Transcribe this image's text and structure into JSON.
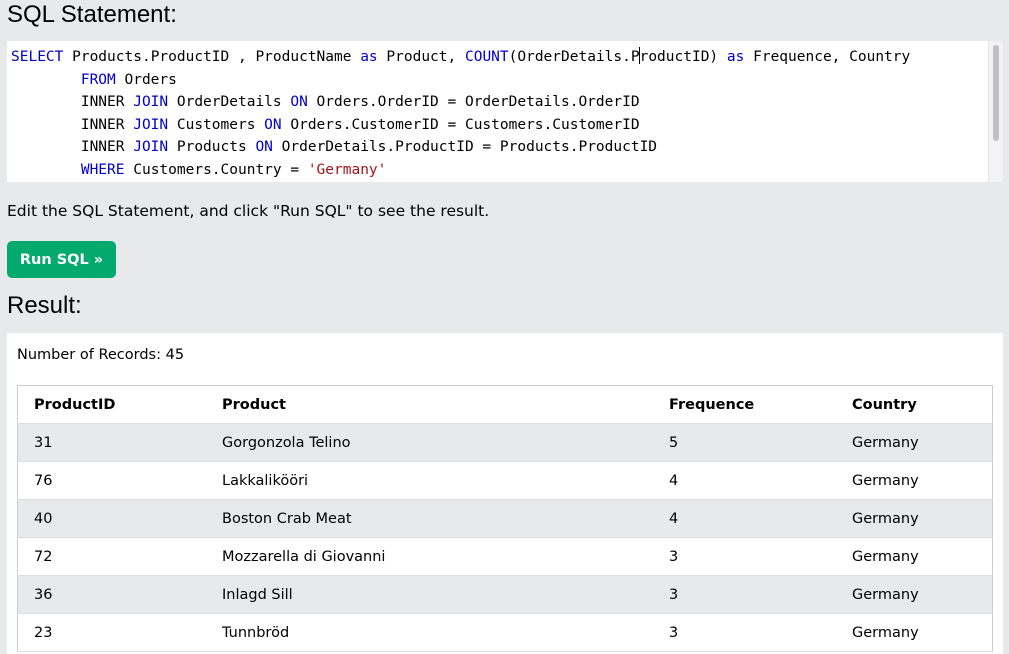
{
  "sql_section": {
    "title": "SQL Statement:",
    "lines": [
      [
        {
          "t": "SELECT",
          "k": "kw"
        },
        {
          "t": " Products.ProductID , ProductName ",
          "k": ""
        },
        {
          "t": "as",
          "k": "kw"
        },
        {
          "t": " Product, ",
          "k": ""
        },
        {
          "t": "COUNT",
          "k": "kw"
        },
        {
          "t": "(OrderDetails.P",
          "k": ""
        },
        {
          "t": "",
          "k": "cursor"
        },
        {
          "t": "roductID) ",
          "k": ""
        },
        {
          "t": "as",
          "k": "kw"
        },
        {
          "t": " Frequence, Country",
          "k": ""
        }
      ],
      [
        {
          "t": "        ",
          "k": ""
        },
        {
          "t": "FROM",
          "k": "kw"
        },
        {
          "t": " Orders",
          "k": ""
        }
      ],
      [
        {
          "t": "        INNER ",
          "k": ""
        },
        {
          "t": "JOIN",
          "k": "kw"
        },
        {
          "t": " OrderDetails ",
          "k": ""
        },
        {
          "t": "ON",
          "k": "kw"
        },
        {
          "t": " Orders.OrderID = OrderDetails.OrderID",
          "k": ""
        }
      ],
      [
        {
          "t": "        INNER ",
          "k": ""
        },
        {
          "t": "JOIN",
          "k": "kw"
        },
        {
          "t": " Customers ",
          "k": ""
        },
        {
          "t": "ON",
          "k": "kw"
        },
        {
          "t": " Orders.CustomerID = Customers.CustomerID",
          "k": ""
        }
      ],
      [
        {
          "t": "        INNER ",
          "k": ""
        },
        {
          "t": "JOIN",
          "k": "kw"
        },
        {
          "t": " Products ",
          "k": ""
        },
        {
          "t": "ON",
          "k": "kw"
        },
        {
          "t": " OrderDetails.ProductID = Products.ProductID",
          "k": ""
        }
      ],
      [
        {
          "t": "        ",
          "k": ""
        },
        {
          "t": "WHERE",
          "k": "kw"
        },
        {
          "t": " Customers.Country = ",
          "k": ""
        },
        {
          "t": "'Germany'",
          "k": "str"
        }
      ]
    ]
  },
  "hint": "Edit the SQL Statement, and click \"Run SQL\" to see the result.",
  "run_button": {
    "label": "Run SQL »",
    "color": "#04aa6d"
  },
  "result_section": {
    "title": "Result:",
    "records_label": "Number of Records: 45",
    "columns": [
      "ProductID",
      "Product",
      "Frequence",
      "Country"
    ],
    "rows": [
      [
        "31",
        "Gorgonzola Telino",
        "5",
        "Germany"
      ],
      [
        "76",
        "Lakkalikööri",
        "4",
        "Germany"
      ],
      [
        "40",
        "Boston Crab Meat",
        "4",
        "Germany"
      ],
      [
        "72",
        "Mozzarella di Giovanni",
        "3",
        "Germany"
      ],
      [
        "36",
        "Inlagd Sill",
        "3",
        "Germany"
      ],
      [
        "23",
        "Tunnbröd",
        "3",
        "Germany"
      ]
    ]
  },
  "colors": {
    "background": "#e7e9eb",
    "keyword": "#0000c8",
    "string": "#a31515"
  }
}
